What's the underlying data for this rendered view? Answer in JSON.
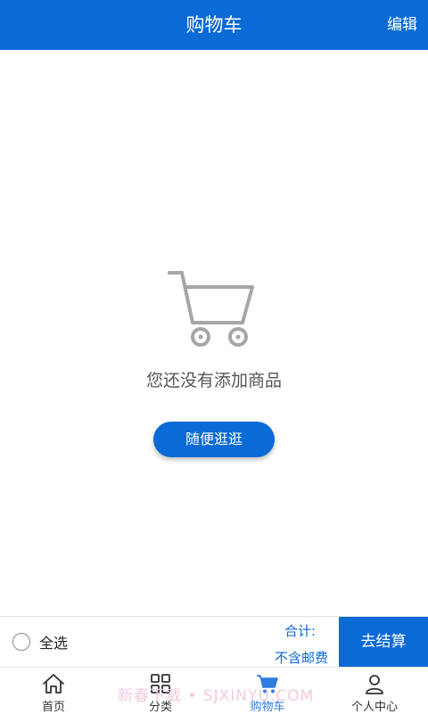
{
  "header": {
    "title": "购物车",
    "edit_label": "编辑"
  },
  "empty_state": {
    "icon": "shopping-cart-icon",
    "message": "您还没有添加商品",
    "button_label": "随便逛逛"
  },
  "checkout_bar": {
    "select_all_label": "全选",
    "total_label": "合计:",
    "shipping_note": "不含邮费",
    "checkout_label": "去结算"
  },
  "tabbar": {
    "items": [
      {
        "label": "首页",
        "icon": "home-icon"
      },
      {
        "label": "分类",
        "icon": "category-icon"
      },
      {
        "label": "购物车",
        "icon": "cart-icon",
        "active": true
      },
      {
        "label": "个人中心",
        "icon": "user-icon"
      }
    ]
  },
  "watermark": "新春下载 • SJXINYU.COM",
  "colors": {
    "primary": "#0a6ad6",
    "active_tab": "#2f7be0"
  }
}
